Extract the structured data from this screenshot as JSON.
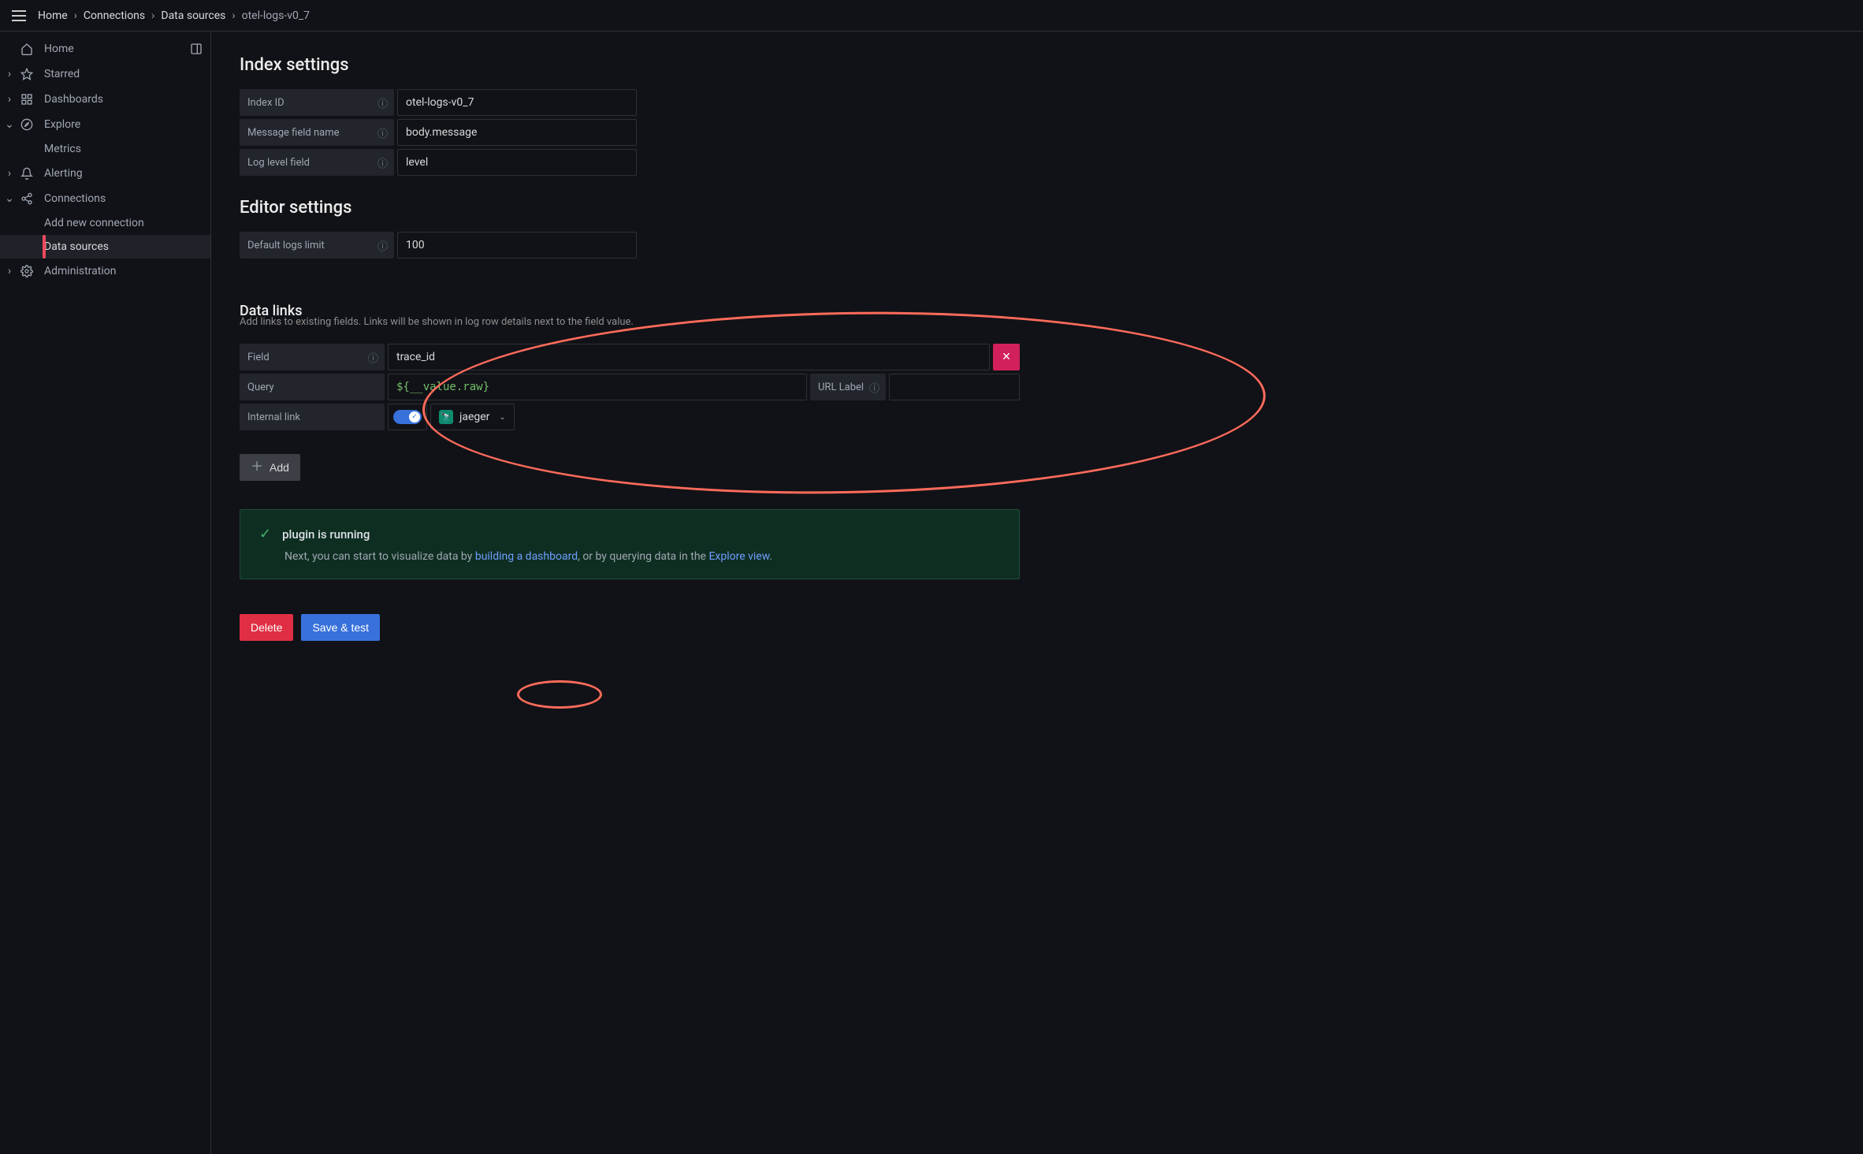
{
  "breadcrumb": [
    "Home",
    "Connections",
    "Data sources",
    "otel-logs-v0_7"
  ],
  "sidebar": {
    "items": [
      {
        "label": "Home",
        "icon": "house",
        "has_chevron": false,
        "right_icon": "panels"
      },
      {
        "label": "Starred",
        "icon": "star",
        "has_chevron": true
      },
      {
        "label": "Dashboards",
        "icon": "grid",
        "has_chevron": true
      },
      {
        "label": "Explore",
        "icon": "compass",
        "has_chevron": true,
        "expanded": true,
        "children": [
          {
            "label": "Metrics"
          }
        ]
      },
      {
        "label": "Alerting",
        "icon": "bell",
        "has_chevron": true
      },
      {
        "label": "Connections",
        "icon": "share",
        "has_chevron": true,
        "expanded": true,
        "children": [
          {
            "label": "Add new connection"
          },
          {
            "label": "Data sources",
            "active": true
          }
        ]
      },
      {
        "label": "Administration",
        "icon": "gear",
        "has_chevron": true
      }
    ]
  },
  "sections": {
    "index": {
      "title": "Index settings",
      "rows": [
        {
          "label": "Index ID",
          "value": "otel-logs-v0_7"
        },
        {
          "label": "Message field name",
          "placeholder": "body.message"
        },
        {
          "label": "Log level field",
          "placeholder": "level"
        }
      ]
    },
    "editor": {
      "title": "Editor settings",
      "rows": [
        {
          "label": "Default logs limit",
          "value": "100"
        }
      ]
    },
    "datalinks": {
      "title": "Data links",
      "subtext": "Add links to existing fields. Links will be shown in log row details next to the field value.",
      "field_label": "Field",
      "field_value": "trace_id",
      "query_label": "Query",
      "query_value": "${__value.raw}",
      "url_label_label": "URL Label",
      "url_label_value": "",
      "internal_link_label": "Internal link",
      "internal_link_on": true,
      "ds_select_value": "jaeger",
      "add_button": "Add"
    }
  },
  "alert": {
    "title": "plugin is running",
    "body_pre": "Next, you can start to visualize data by ",
    "link1": "building a dashboard",
    "body_mid": ", or by querying data in the ",
    "link2": "Explore view",
    "body_post": "."
  },
  "buttons": {
    "delete": "Delete",
    "save": "Save & test"
  }
}
